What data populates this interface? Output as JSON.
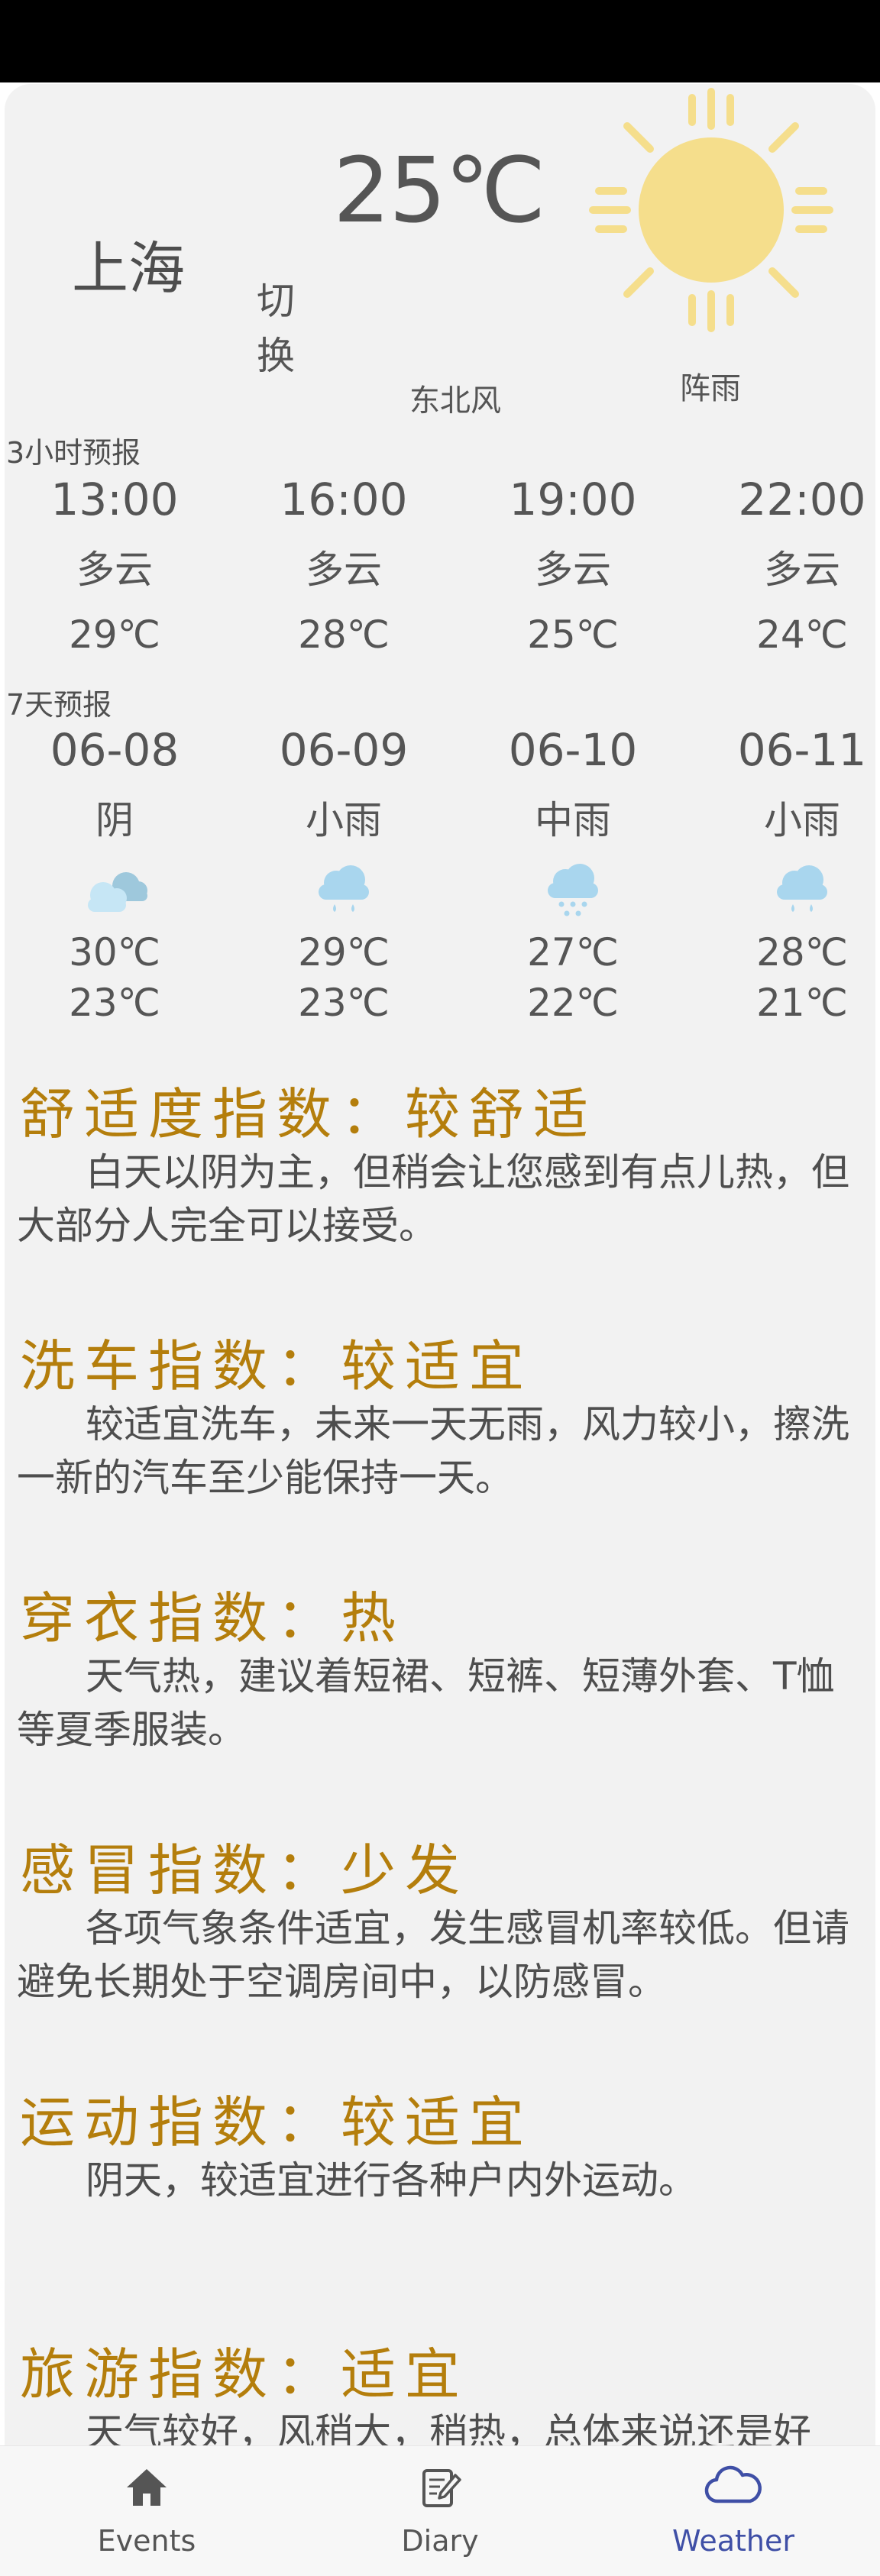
{
  "colors": {
    "accent": "#3f4fa6",
    "index_title": "#b47e0c",
    "sun": "#f5de8c",
    "rain_icon": "#a9d6ee"
  },
  "current": {
    "city": "上海",
    "switch_label": "切换",
    "temperature": "25℃",
    "wind": "东北风",
    "condition": "阵雨",
    "condition_icon": "sun-icon"
  },
  "hourly": {
    "label": "3小时预报",
    "items": [
      {
        "time": "13:00",
        "desc": "多云",
        "temp": "29℃"
      },
      {
        "time": "16:00",
        "desc": "多云",
        "temp": "28℃"
      },
      {
        "time": "19:00",
        "desc": "多云",
        "temp": "25℃"
      },
      {
        "time": "22:00",
        "desc": "多云",
        "temp": "24℃"
      }
    ]
  },
  "daily": {
    "label": "7天预报",
    "items": [
      {
        "date": "06-08",
        "desc": "阴",
        "icon": "overcast-icon",
        "high": "30℃",
        "low": "23℃"
      },
      {
        "date": "06-09",
        "desc": "小雨",
        "icon": "light-rain-icon",
        "high": "29℃",
        "low": "23℃"
      },
      {
        "date": "06-10",
        "desc": "中雨",
        "icon": "moderate-rain-icon",
        "high": "27℃",
        "low": "22℃"
      },
      {
        "date": "06-11",
        "desc": "小雨",
        "icon": "light-rain-icon",
        "high": "28℃",
        "low": "21℃"
      }
    ]
  },
  "indices": [
    {
      "title": "舒适度指数：较舒适",
      "body": "白天以阴为主，但稍会让您感到有点儿热，但大部分人完全可以接受。"
    },
    {
      "title": "洗车指数：较适宜",
      "body": "较适宜洗车，未来一天无雨，风力较小，擦洗一新的汽车至少能保持一天。"
    },
    {
      "title": "穿衣指数：热",
      "body": "天气热，建议着短裙、短裤、短薄外套、T恤等夏季服装。"
    },
    {
      "title": "感冒指数：少发",
      "body": "各项气象条件适宜，发生感冒机率较低。但请避免长期处于空调房间中，以防感冒。"
    },
    {
      "title": "运动指数：较适宜",
      "body": "阴天，较适宜进行各种户内外运动。"
    },
    {
      "title": "旅游指数：适宜",
      "body": "天气较好，风稍大，稍热，总体来说还是好"
    }
  ],
  "nav": {
    "items": [
      {
        "label": "Events",
        "icon": "home-icon"
      },
      {
        "label": "Diary",
        "icon": "diary-icon"
      },
      {
        "label": "Weather",
        "icon": "cloud-icon"
      }
    ],
    "active": "Weather"
  }
}
